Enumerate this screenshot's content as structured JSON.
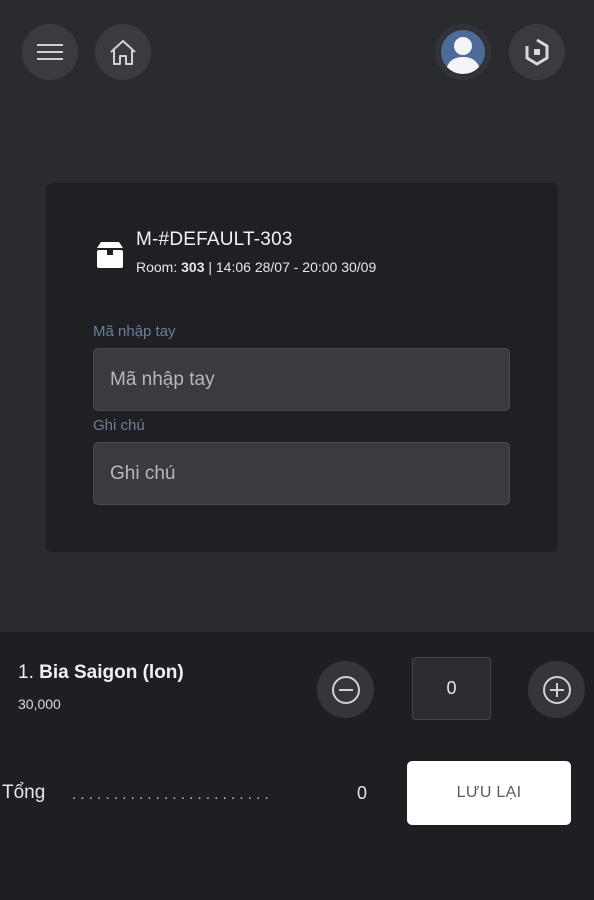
{
  "header": {
    "menu_icon": "hamburger-menu-icon",
    "home_icon": "home-icon",
    "avatar_icon": "user-avatar-icon",
    "logo_icon": "app-logo-icon"
  },
  "order": {
    "code": "M-#DEFAULT-303",
    "room_label": "Room: ",
    "room_number": "303",
    "time_range": " | 14:06 28/07 - 20:00 30/09"
  },
  "form": {
    "manual_code": {
      "label": "Mã nhập tay",
      "placeholder": "Mã nhập tay",
      "value": ""
    },
    "note": {
      "label": "Ghi chú",
      "placeholder": "Ghi chú",
      "value": ""
    }
  },
  "item": {
    "index": "1. ",
    "name": "Bia Saigon (lon)",
    "price": "30,000",
    "quantity": "0"
  },
  "summary": {
    "total_label": "Tổng",
    "dots": "........................",
    "total_value": "0",
    "save_label": "LƯU LẠI"
  },
  "colors": {
    "background": "#2a2b2f",
    "card": "#1f2024",
    "input": "#3a3b40",
    "label_accent": "#6b7e9a",
    "save_button": "#ffffff"
  }
}
